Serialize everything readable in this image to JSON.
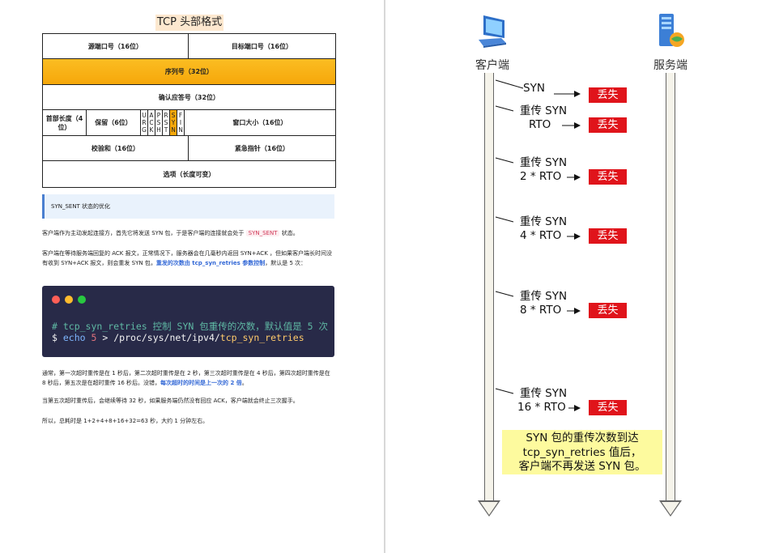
{
  "left": {
    "tcp_title": "TCP 头部格式",
    "tcp": {
      "src_port": "源端口号（16位）",
      "dst_port": "目标端口号（16位）",
      "seq": "序列号（32位）",
      "ack": "确认应答号（32位）",
      "header_len": "首部长度（4位）",
      "reserved": "保留（6位）",
      "flags": [
        [
          "U",
          "R",
          "G"
        ],
        [
          "A",
          "C",
          "K"
        ],
        [
          "P",
          "S",
          "H"
        ],
        [
          "R",
          "S",
          "T"
        ],
        [
          "S",
          "Y",
          "N"
        ],
        [
          "F",
          "I",
          "N"
        ]
      ],
      "window": "窗口大小（16位）",
      "checksum": "校验和（16位）",
      "urgent": "紧急指针（16位）",
      "options": "选项（长度可变）"
    },
    "callout": "SYN_SENT 状态的优化",
    "para1": {
      "a": "客户端作为主动发起连接方，首先它将发送 SYN 包，于是客户端的连接就会处于",
      "tag": "SYN_SENT",
      "b": "状态。"
    },
    "para2": {
      "a": "客户端在等待服务端回复的 ACK 报文，正常情况下，服务器会在几毫秒内返回 SYN+ACK ，但如果客户端长时间没有收到 SYN+ACK 报文，则会重发 SYN 包，",
      "hl": "重发的次数由 tcp_syn_retries 参数控制",
      "b": "，默认是 5 次："
    },
    "code": {
      "comment": "# tcp_syn_retries 控制 SYN 包重传的次数，默认值是 5 次",
      "cmd_dollar": "$",
      "cmd_echo": "echo",
      "cmd_num": "5",
      "cmd_path": "> /proc/sys/net/ipv4/",
      "cmd_file": "tcp_syn_retries"
    },
    "para3": {
      "a": "通常，第一次超时重传是在 1 秒后，第二次超时重传是在 2 秒，第三次超时重传是在 4 秒后，第四次超时重传是在 8 秒后，第五次是在超时重传 16 秒后。没错，",
      "hl": "每次超时的时间是上一次的 2 倍",
      "b": "。"
    },
    "para4": "当第五次超时重传后，会继续等待 32 秒，如果服务端仍然没有回应 ACK，客户端就会终止三次握手。",
    "para5": "所以，总耗时是 1+2+4+8+16+32=63 秒，大约 1 分钟左右。"
  },
  "right": {
    "client_label": "客户端",
    "server_label": "服务端",
    "messages": [
      {
        "l1": "SYN",
        "l2": ""
      },
      {
        "l1": "重传 SYN",
        "l2": "RTO"
      },
      {
        "l1": "重传 SYN",
        "l2": "2 * RTO"
      },
      {
        "l1": "重传 SYN",
        "l2": "4 * RTO"
      },
      {
        "l1": "重传 SYN",
        "l2": "8 * RTO"
      },
      {
        "l1": "重传 SYN",
        "l2": "16 * RTO"
      }
    ],
    "lost_label": "丢失",
    "note": [
      "SYN 包的重传次数到达",
      "tcp_syn_retries 值后，",
      "客户端不再发送 SYN 包。"
    ]
  },
  "colors": {
    "seq_row": "#f6a70a",
    "lost_box": "#e0141b",
    "note_bg": "#fdfa9e",
    "code_bg": "#282a48"
  }
}
